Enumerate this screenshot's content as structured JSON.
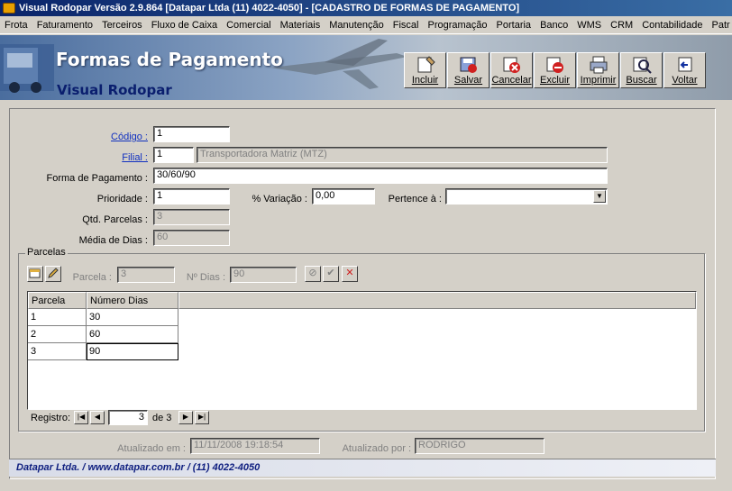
{
  "window": {
    "title": "Visual Rodopar Versão 2.9.864 [Datapar Ltda (11) 4022-4050]  - [CADASTRO DE FORMAS DE PAGAMENTO]"
  },
  "menu": [
    "Frota",
    "Faturamento",
    "Terceiros",
    "Fluxo de Caixa",
    "Comercial",
    "Materiais",
    "Manutenção",
    "Fiscal",
    "Programação",
    "Portaria",
    "Banco",
    "WMS",
    "CRM",
    "Contabilidade",
    "Patr"
  ],
  "banner": {
    "title": "Formas de Pagamento",
    "subtitle": "Visual Rodopar"
  },
  "toolbar": {
    "incluir": "Incluir",
    "salvar": "Salvar",
    "cancelar": "Cancelar",
    "excluir": "Excluir",
    "imprimir": "Imprimir",
    "buscar": "Buscar",
    "voltar": "Voltar"
  },
  "form": {
    "codigo_label": "Código :",
    "codigo_value": "1",
    "filial_label": "Filial :",
    "filial_code": "1",
    "filial_name": "Transportadora Matriz (MTZ)",
    "forma_label": "Forma de Pagamento :",
    "forma_value": "30/60/90",
    "prioridade_label": "Prioridade :",
    "prioridade_value": "1",
    "variacao_label": "% Variação :",
    "variacao_value": "0,00",
    "pertence_label": "Pertence à :",
    "pertence_value": "",
    "qtd_label": "Qtd. Parcelas :",
    "qtd_value": "3",
    "media_label": "Média de Dias :",
    "media_value": "60"
  },
  "parcelas": {
    "legend": "Parcelas",
    "parcela_label": "Parcela :",
    "parcela_value": "3",
    "dias_label": "Nº Dias :",
    "dias_value": "90",
    "columns": [
      "Parcela",
      "Número Dias"
    ],
    "rows": [
      [
        "1",
        "30"
      ],
      [
        "2",
        "60"
      ],
      [
        "3",
        "90"
      ]
    ],
    "registro_label": "Registro:",
    "registro_value": "3",
    "registro_total": "de 3"
  },
  "audit": {
    "atualizado_em_label": "Atualizado em :",
    "atualizado_em_value": "11/11/2008 19:18:54",
    "atualizado_por_label": "Atualizado por :",
    "atualizado_por_value": "RODRIGO"
  },
  "footer": {
    "text": "Datapar Ltda.  /  www.datapar.com.br  /  (11) 4022-4050"
  }
}
